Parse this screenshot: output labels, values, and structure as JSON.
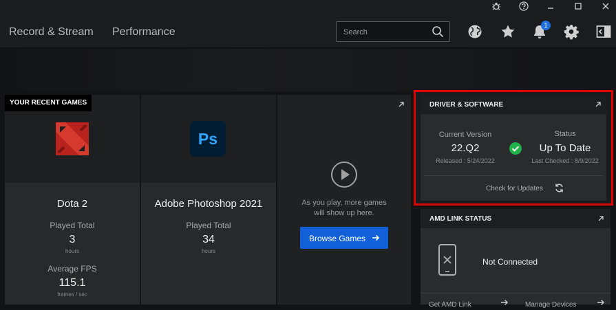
{
  "titlebar": {
    "buttons": [
      "bug-icon",
      "help-icon",
      "minimize-icon",
      "maximize-icon",
      "close-icon"
    ]
  },
  "nav": {
    "tabs": [
      "Record & Stream",
      "Performance"
    ],
    "search_placeholder": "Search",
    "notification_count": "1"
  },
  "recent_games": {
    "title": "YOUR RECENT GAMES",
    "games": [
      {
        "name": "Dota 2",
        "played_label": "Played Total",
        "played_value": "3",
        "played_unit": "hours",
        "fps_label": "Average FPS",
        "fps_value": "115.1",
        "fps_unit": "frames / sec"
      },
      {
        "name": "Adobe Photoshop 2021",
        "played_label": "Played Total",
        "played_value": "34",
        "played_unit": "hours",
        "logo_text": "Ps"
      }
    ],
    "placeholder_text": "As you play, more games will show up here.",
    "browse_label": "Browse Games"
  },
  "driver": {
    "title": "DRIVER & SOFTWARE",
    "current_label": "Current Version",
    "current_value": "22.Q2",
    "released": "Released : 5/24/2022",
    "status_label": "Status",
    "status_value": "Up To Date",
    "last_checked": "Last Checked : 8/9/2022",
    "check_label": "Check for Updates",
    "highlight_color": "#e00000",
    "ok_color": "#21b14a"
  },
  "amd_link": {
    "title": "AMD LINK STATUS",
    "status": "Not Connected",
    "bottom_left": "Get AMD Link",
    "bottom_right": "Manage Devices"
  }
}
